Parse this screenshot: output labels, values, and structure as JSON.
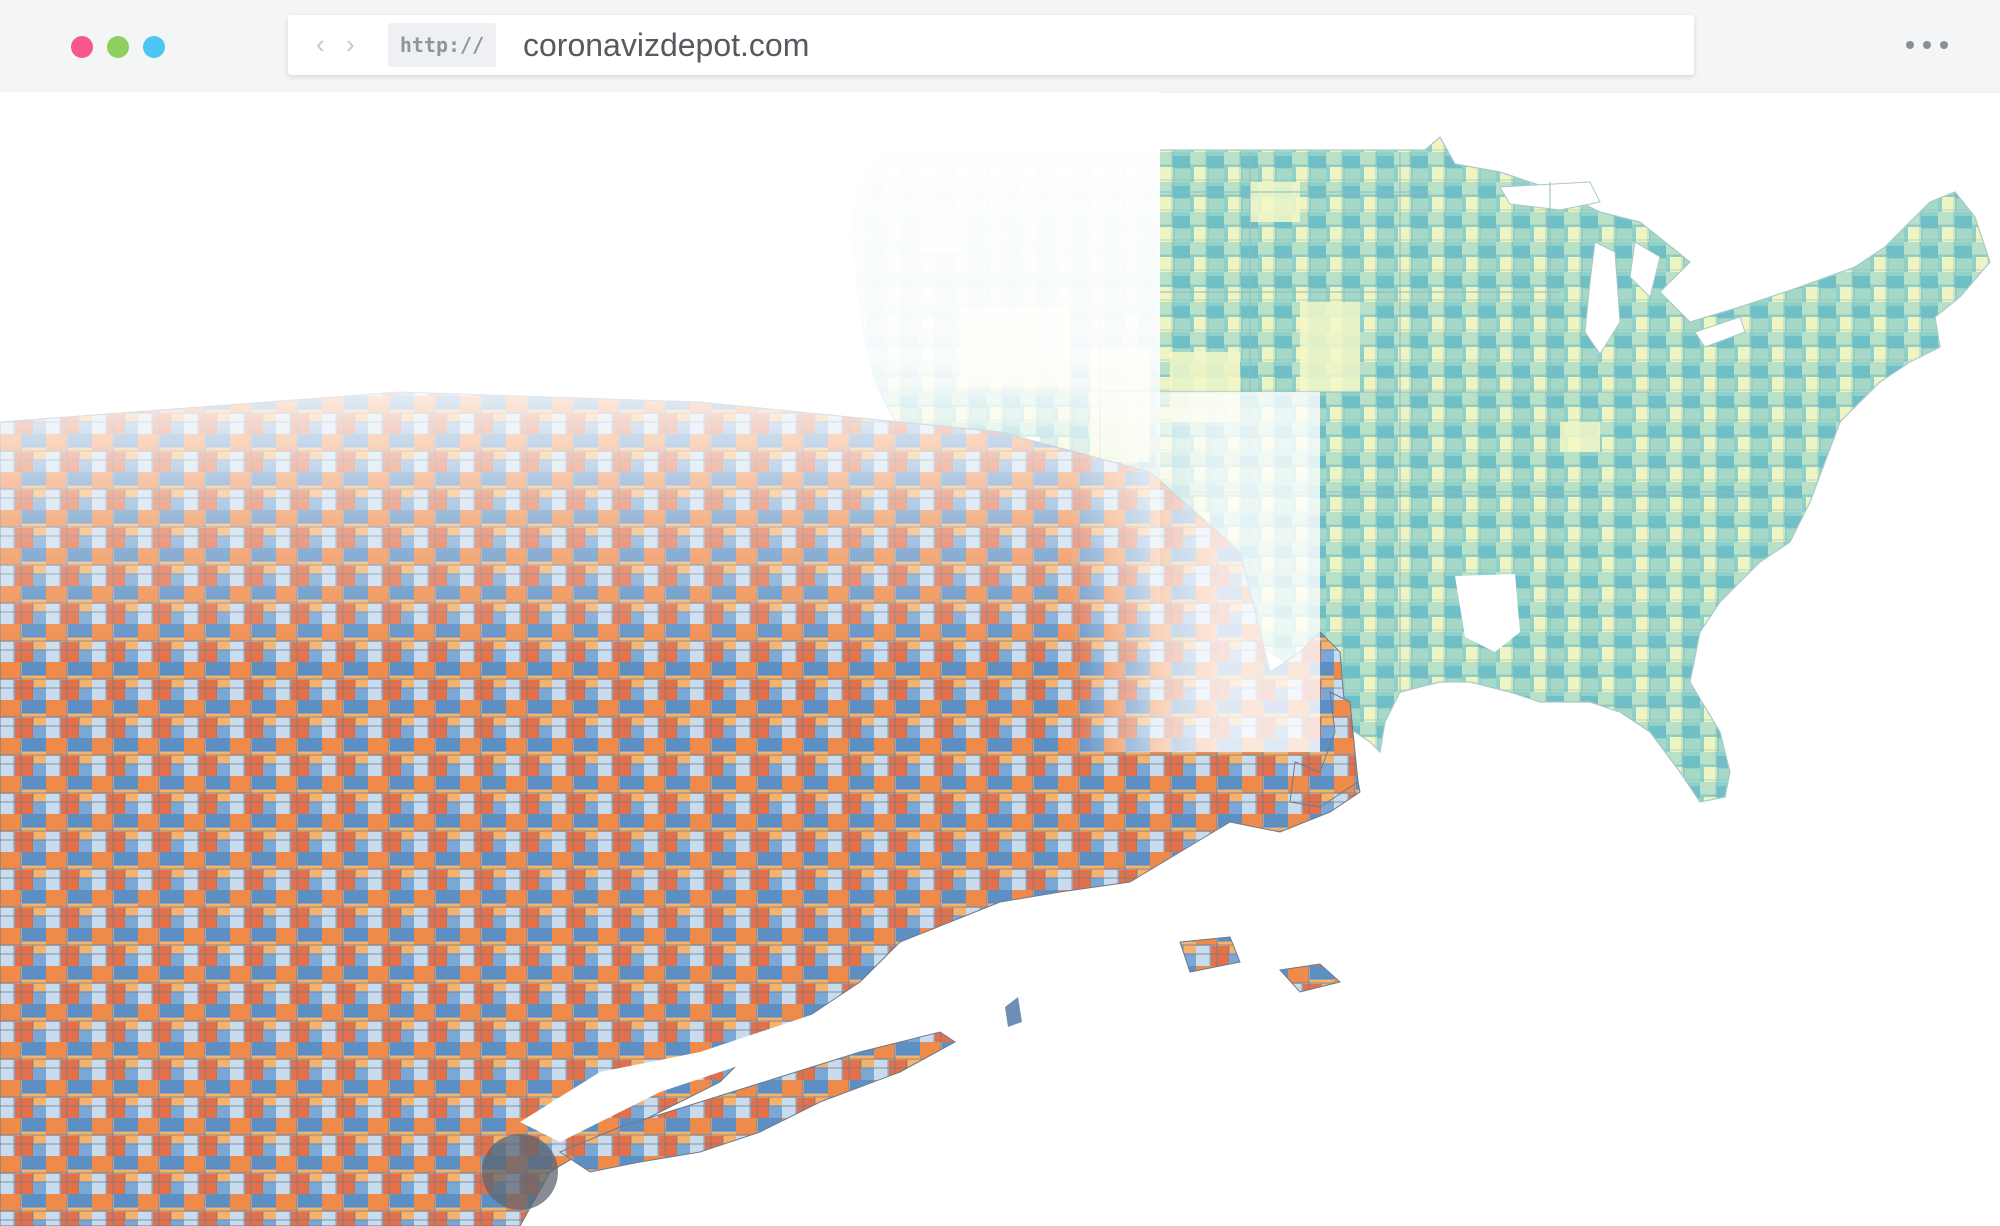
{
  "browser": {
    "window_controls": [
      "close",
      "minimize",
      "maximize"
    ],
    "back_icon": "chevron-left-icon",
    "forward_icon": "chevron-right-icon",
    "protocol": "http://",
    "url": "coronavizdepot.com",
    "menu_icon": "more-horizontal-icon"
  },
  "colors": {
    "close": "#f7578b",
    "minimize": "#8fcf5d",
    "maximize": "#4dc6f3",
    "us_map_low": "#f4f8c8",
    "us_map_high": "#5fb8c4",
    "ne_map_orange": "#ee8a4a",
    "ne_map_blue": "#5e8fc2"
  }
}
